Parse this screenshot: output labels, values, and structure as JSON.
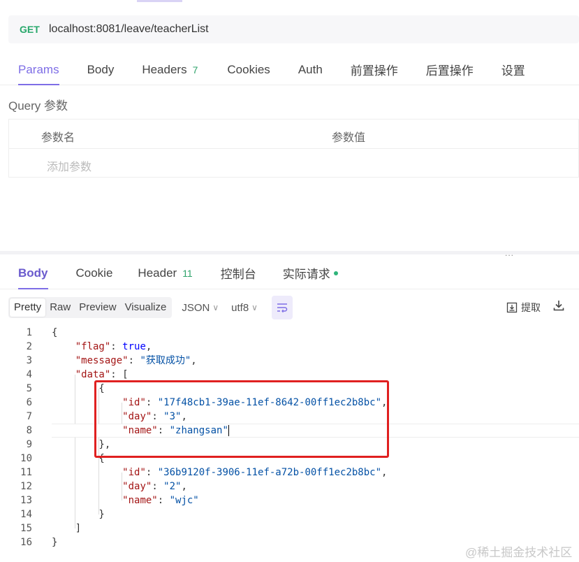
{
  "request": {
    "method": "GET",
    "url": "localhost:8081/leave/teacherList",
    "tabs": [
      {
        "label": "Params",
        "count": ""
      },
      {
        "label": "Body",
        "count": ""
      },
      {
        "label": "Headers",
        "count": "7"
      },
      {
        "label": "Cookies",
        "count": ""
      },
      {
        "label": "Auth",
        "count": ""
      },
      {
        "label": "前置操作",
        "count": ""
      },
      {
        "label": "后置操作",
        "count": ""
      },
      {
        "label": "设置",
        "count": ""
      }
    ],
    "query_label": "Query 参数",
    "param_name_header": "参数名",
    "param_value_header": "参数值",
    "add_param_placeholder": "添加参数"
  },
  "drag_handle": "...",
  "response": {
    "tabs": [
      {
        "label": "Body",
        "count": ""
      },
      {
        "label": "Cookie",
        "count": ""
      },
      {
        "label": "Header",
        "count": "11"
      },
      {
        "label": "控制台",
        "count": ""
      },
      {
        "label": "实际请求",
        "count": ""
      }
    ],
    "view_modes": [
      "Pretty",
      "Raw",
      "Preview",
      "Visualize"
    ],
    "active_view": "Pretty",
    "format": "JSON",
    "encoding": "utf8",
    "extract_label": "提取",
    "lines": [
      "1",
      "2",
      "3",
      "4",
      "5",
      "6",
      "7",
      "8",
      "9",
      "10",
      "11",
      "12",
      "13",
      "14",
      "15",
      "16"
    ],
    "json": {
      "flag_key": "\"flag\"",
      "flag_val": "true",
      "message_key": "\"message\"",
      "message_val": "\"获取成功\"",
      "data_key": "\"data\"",
      "items": [
        {
          "id": "\"17f48cb1-39ae-11ef-8642-00ff1ec2b8bc\"",
          "day": "\"3\"",
          "name": "\"zhangsan\""
        },
        {
          "id": "\"36b9120f-3906-11ef-a72b-00ff1ec2b8bc\"",
          "day": "\"2\"",
          "name": "\"wjc\""
        }
      ]
    }
  },
  "watermark": "@稀土掘金技术社区",
  "colors": {
    "accent": "#7e6ee6",
    "method": "#28a86b",
    "highlight": "#e02020"
  }
}
